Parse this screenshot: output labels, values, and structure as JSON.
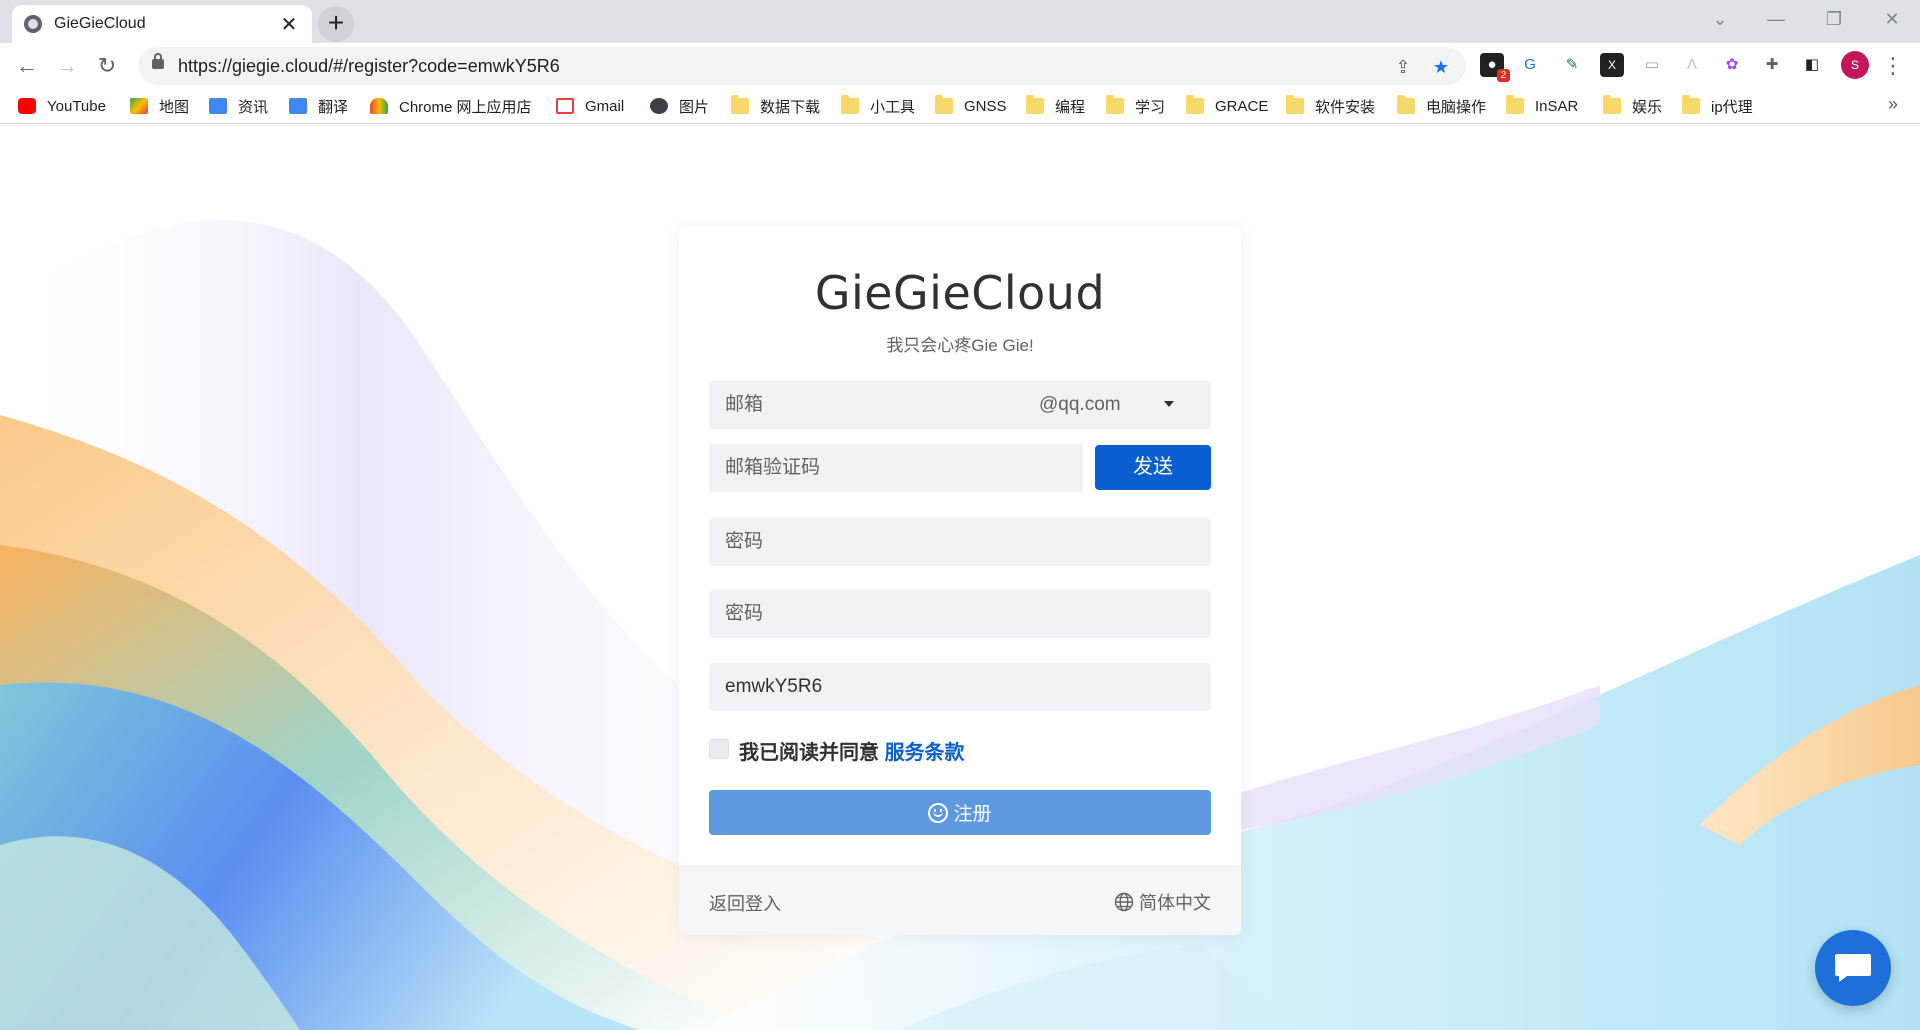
{
  "browser": {
    "tab_title": "GieGieCloud",
    "tab_close": "✕",
    "new_tab": "+",
    "url": "https://giegie.cloud/#/register?code=emwkY5R6",
    "extension_badge": "2",
    "profile_initial": "S",
    "bookmarks": [
      {
        "label": "YouTube",
        "icon": "youtube-icon"
      },
      {
        "label": "地图",
        "icon": "maps-icon"
      },
      {
        "label": "资讯",
        "icon": "news-icon"
      },
      {
        "label": "翻译",
        "icon": "translate-icon"
      },
      {
        "label": "Chrome 网上应用店",
        "icon": "webstore-icon"
      },
      {
        "label": "Gmail",
        "icon": "gmail-icon"
      },
      {
        "label": "图片",
        "icon": "globe-icon"
      },
      {
        "label": "数据下载",
        "icon": "folder-icon"
      },
      {
        "label": "小工具",
        "icon": "folder-icon"
      },
      {
        "label": "GNSS",
        "icon": "folder-icon"
      },
      {
        "label": "编程",
        "icon": "folder-icon"
      },
      {
        "label": "学习",
        "icon": "folder-icon"
      },
      {
        "label": "GRACE",
        "icon": "folder-icon"
      },
      {
        "label": "软件安装",
        "icon": "folder-icon"
      },
      {
        "label": "电脑操作",
        "icon": "folder-icon"
      },
      {
        "label": "InSAR",
        "icon": "folder-icon"
      },
      {
        "label": "娱乐",
        "icon": "folder-icon"
      },
      {
        "label": "ip代理",
        "icon": "folder-icon"
      }
    ],
    "bookmarks_more": "»"
  },
  "page": {
    "title": "GieGieCloud",
    "subtitle": "我只会心疼Gie Gie!",
    "email_placeholder": "邮箱",
    "email_suffix": "@qq.com",
    "code_placeholder": "邮箱验证码",
    "send_label": "发送",
    "password_placeholder": "密码",
    "confirm_password_placeholder": "密码",
    "invite_code_value": "emwkY5R6",
    "agree_text": "我已阅读并同意",
    "terms_link": "服务条款",
    "register_label": "注册",
    "back_to_login": "返回登入",
    "language": "简体中文"
  },
  "colors": {
    "primary": "#0a5fd0",
    "register_button": "#5e98df",
    "field_background": "#f0f2f5",
    "chat_button": "#1e6fd9"
  }
}
